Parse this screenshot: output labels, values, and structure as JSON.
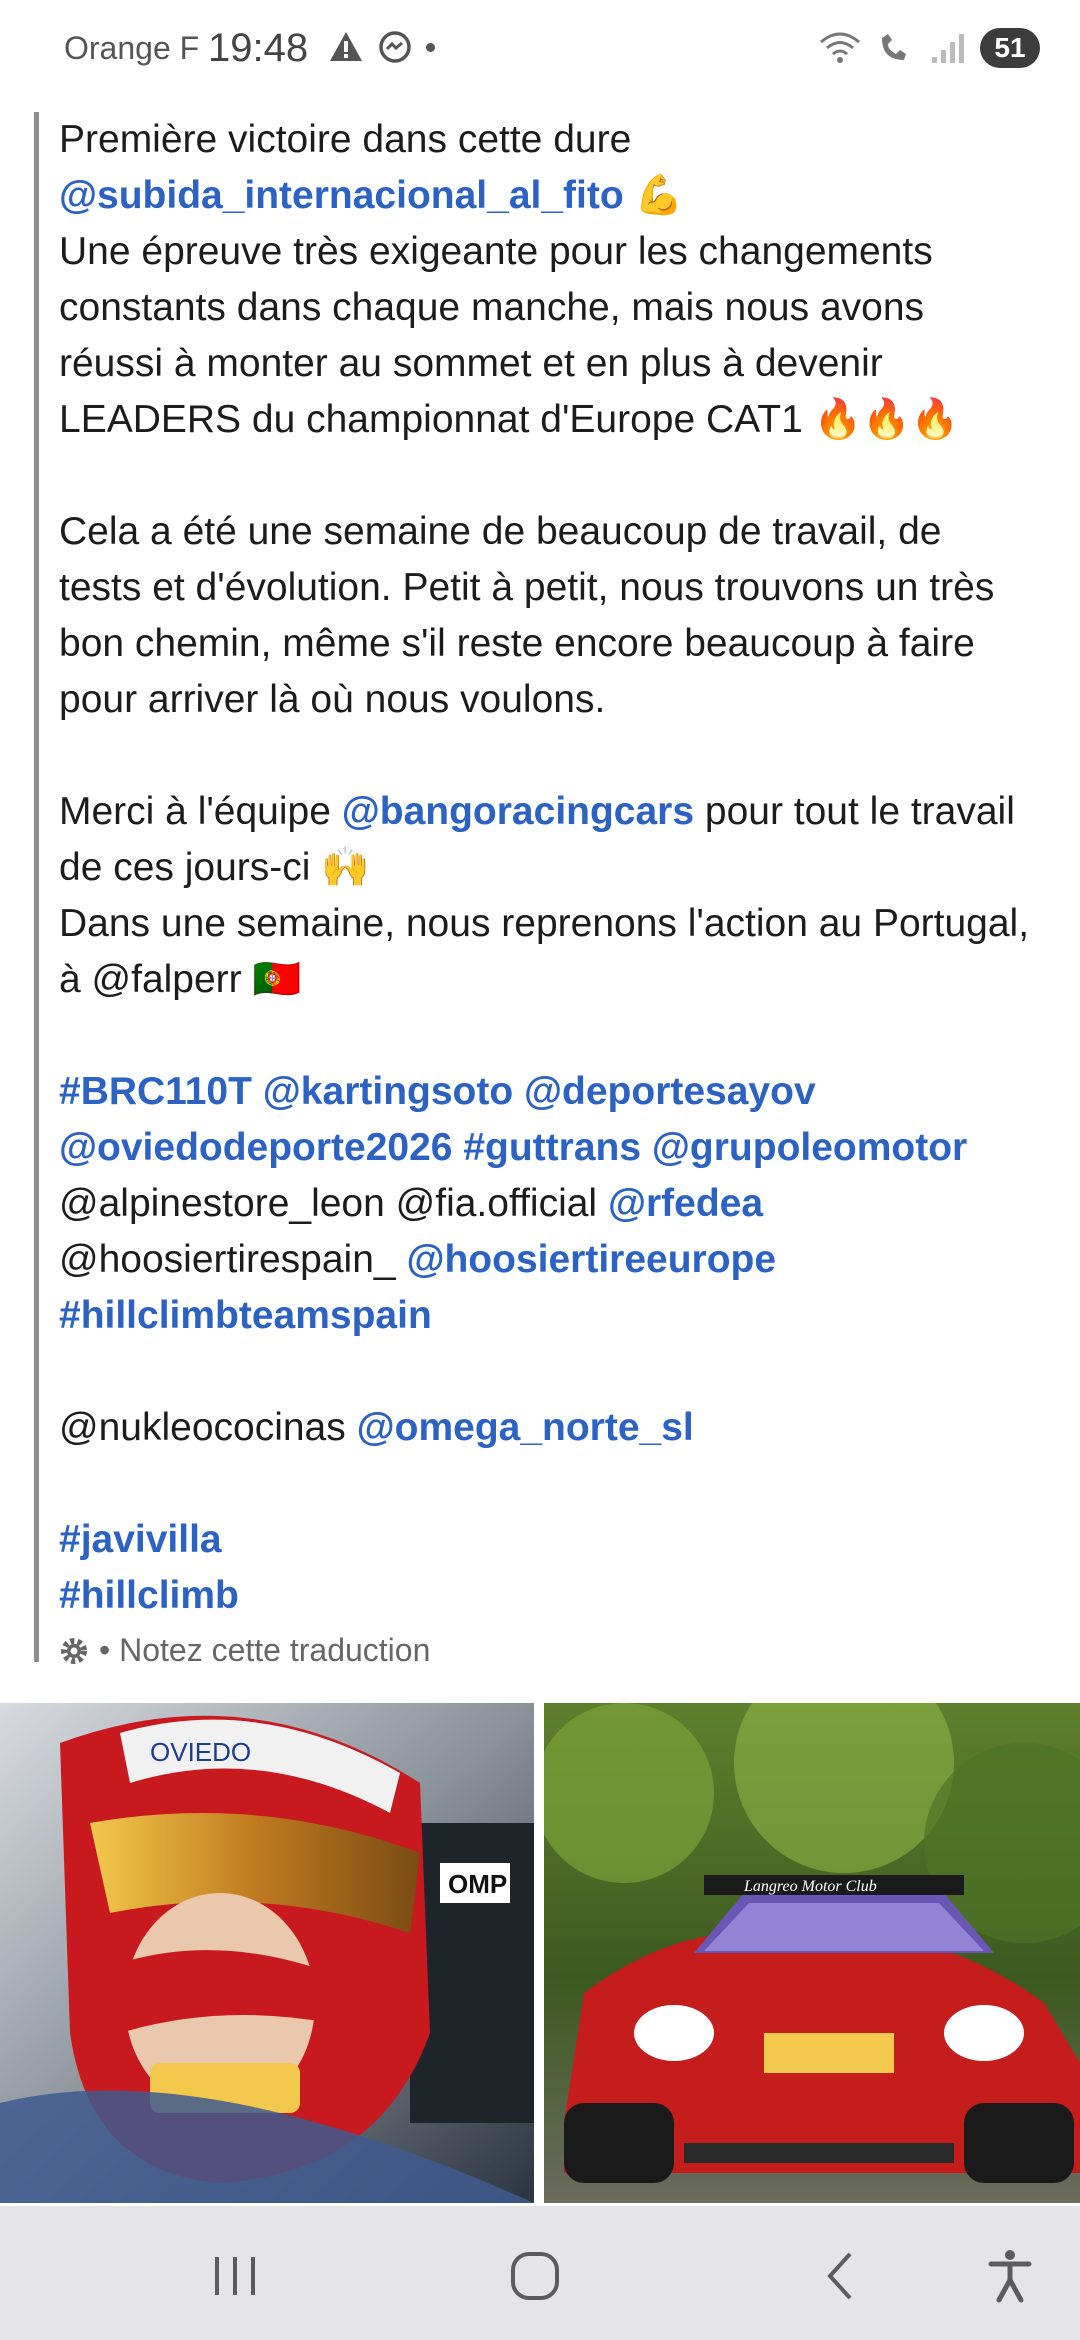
{
  "status_bar": {
    "carrier": "Orange F",
    "time": "19:48",
    "battery": "51"
  },
  "caption": {
    "line1": "Première victoire dans cette dure",
    "mention_fito": "@subida_internacional_al_fito",
    "emoji_muscle": "💪",
    "p1": "Une épreuve très exigeante pour les changements constants dans chaque manche, mais nous avons réussi à monter au sommet et en plus à devenir LEADERS du championnat d'Europe CAT1",
    "emoji_fire": "🔥🔥🔥",
    "p2": "Cela a été une semaine de beaucoup de travail, de tests et d'évolution. Petit à petit, nous trouvons un très bon chemin, même s'il reste encore beaucoup à faire pour arriver là où nous voulons.",
    "p3_before": "Merci à l'équipe ",
    "mention_bango": "@bangoracingcars",
    "p3_after": " pour tout le travail de ces jours-ci",
    "emoji_hands": "🙌",
    "p4": "Dans une semaine, nous reprenons l'action au Portugal, à @falperr",
    "emoji_flag": "🇵🇹",
    "tags": {
      "brc110t": "#BRC110T",
      "kartingsoto": "@kartingsoto",
      "deportesayov": "@deportesayov",
      "oviedodeporte": "@oviedodeporte2026",
      "guttrans": "#guttrans",
      "grupoleomotor": "@grupoleomotor",
      "alpinestore": "@alpinestore_leon @fia.official",
      "rfedea": "@rfedea",
      "hoosierspain": "@hoosiertirespain_",
      "hoosiereurope": "@hoosiertireeurope",
      "hillclimbteam": "#hillclimbteamspain",
      "nukleo": "@nukleococinas",
      "omega": "@omega_norte_sl",
      "javivilla": "#javivilla",
      "hillclimb": "#hillclimb"
    },
    "rate_translation": "• Notez cette traduction"
  },
  "photos": {
    "left_text": "OVIEDO",
    "left_brand": "OMP",
    "right_text": "Langreo Motor Club"
  },
  "colors": {
    "link": "#2b62c4",
    "nav_bg": "#e5e4e9"
  }
}
